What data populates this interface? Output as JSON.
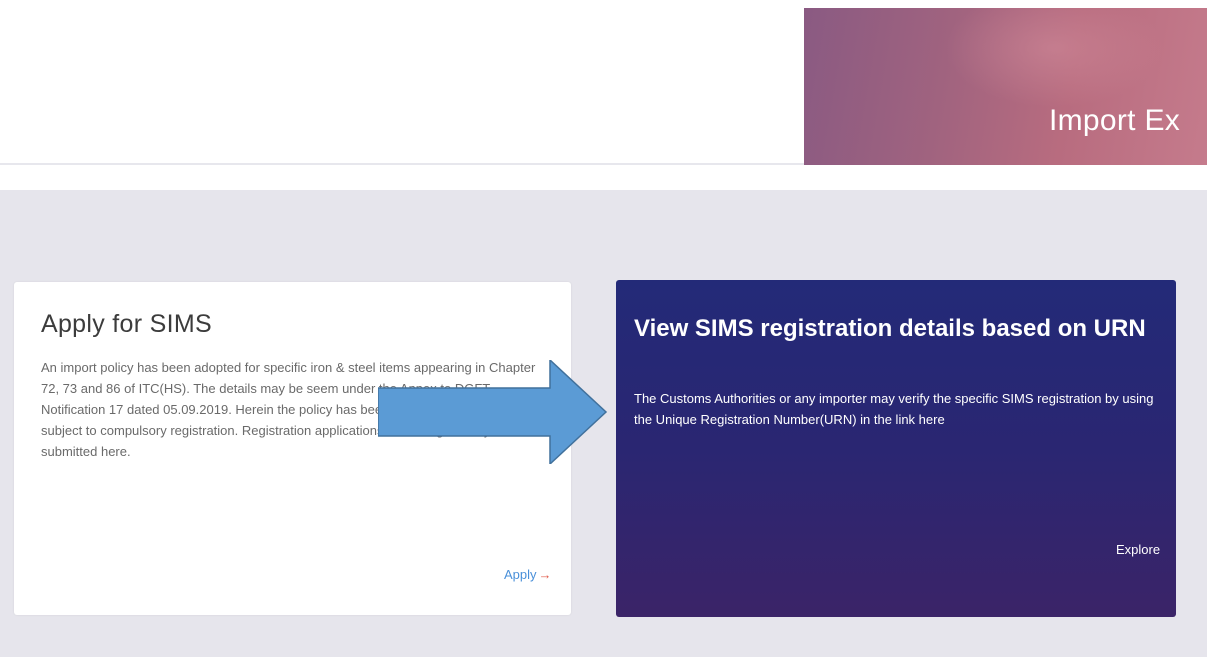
{
  "hero": {
    "title": "Import Ex"
  },
  "apply_card": {
    "title": "Apply for SIMS",
    "description": "An import policy has been adopted for specific iron & steel items appearing in Chapter 72, 73 and 86 of ITC(HS). The details may be seem under the Annex to DGFT Notification 17 dated 05.09.2019. Herein the policy has been changed from free to free subject to compulsory registration. Registration applications in this regard may be submitted here.",
    "link_label": "Apply",
    "link_arrow": "→"
  },
  "view_card": {
    "title": "View SIMS registration details based on URN",
    "description": "The Customs Authorities or any importer may verify the specific SIMS registration by using the Unique Registration Number(URN) in the link here",
    "link_label": "Explore"
  },
  "colors": {
    "band_background": "#e6e5ec",
    "view_card_background": "#262872",
    "apply_link": "#4a90d9",
    "callout_arrow": "#5b9bd5"
  },
  "icons": {
    "callout": "right-arrow-callout-icon"
  }
}
